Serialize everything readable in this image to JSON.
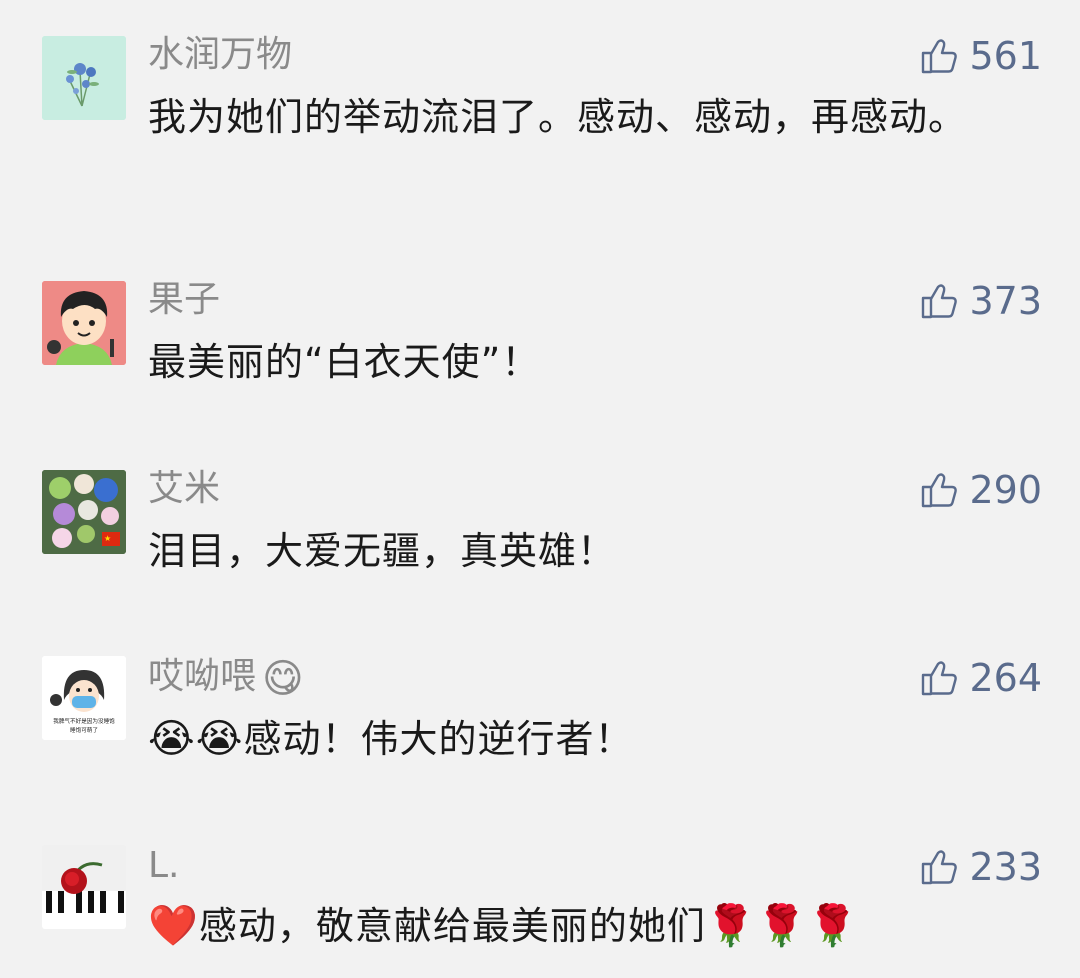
{
  "comments": [
    {
      "nickname": "水润万物",
      "likes": "561",
      "text": "我为她们的举动流泪了。感动、感动，再感动。",
      "avatar_icon": "blue-flower-avatar"
    },
    {
      "nickname": "果子",
      "likes": "373",
      "text": "最美丽的“白衣天使”！",
      "avatar_icon": "cartoon-boy-avatar"
    },
    {
      "nickname": "艾米",
      "likes": "290",
      "text": "泪目，大爱无疆，真英雄！",
      "avatar_icon": "flower-bouquet-avatar"
    },
    {
      "nickname": "哎呦喂",
      "nickname_emoji": "😋",
      "likes": "264",
      "text_prefix_emoji": "😭😭",
      "text": "感动！伟大的逆行者！",
      "avatar_icon": "masked-girl-avatar",
      "avatar_caption_line1": "我脾气不好是因为没睡饱",
      "avatar_caption_line2": "睡饱可萌了"
    },
    {
      "nickname": "L.",
      "likes": "233",
      "text_prefix_emoji": "❤️",
      "text": "感动，敬意献给最美丽的她们",
      "text_suffix_emoji": "🌹🌹🌹",
      "avatar_icon": "rose-piano-avatar"
    }
  ],
  "colors": {
    "background": "#f2f2f2",
    "nickname": "#8a8a8a",
    "like": "#5a6b8c",
    "text": "#1a1a1a"
  }
}
